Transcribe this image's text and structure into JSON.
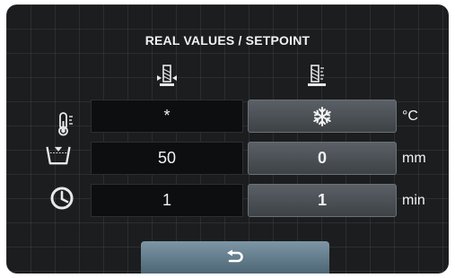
{
  "screen": {
    "title": "REAL VALUES / SETPOINT",
    "columns": {
      "real_icon": "real-value-thermometer-icon",
      "setpoint_icon": "setpoint-thermometer-icon"
    },
    "rows": [
      {
        "icon": "thermometer-icon",
        "real": "*",
        "setpoint": "snowflake-icon",
        "unit": "°C"
      },
      {
        "icon": "water-level-icon",
        "real": "50",
        "setpoint": "0",
        "unit": "mm"
      },
      {
        "icon": "clock-icon",
        "real": "1",
        "setpoint": "1",
        "unit": "min"
      }
    ],
    "back_button": {
      "icon": "back-arrow-icon"
    },
    "colors": {
      "background": "#1b1d1f",
      "setpoint_cell": "#4a4f54",
      "back_button": "#6a8494"
    }
  }
}
